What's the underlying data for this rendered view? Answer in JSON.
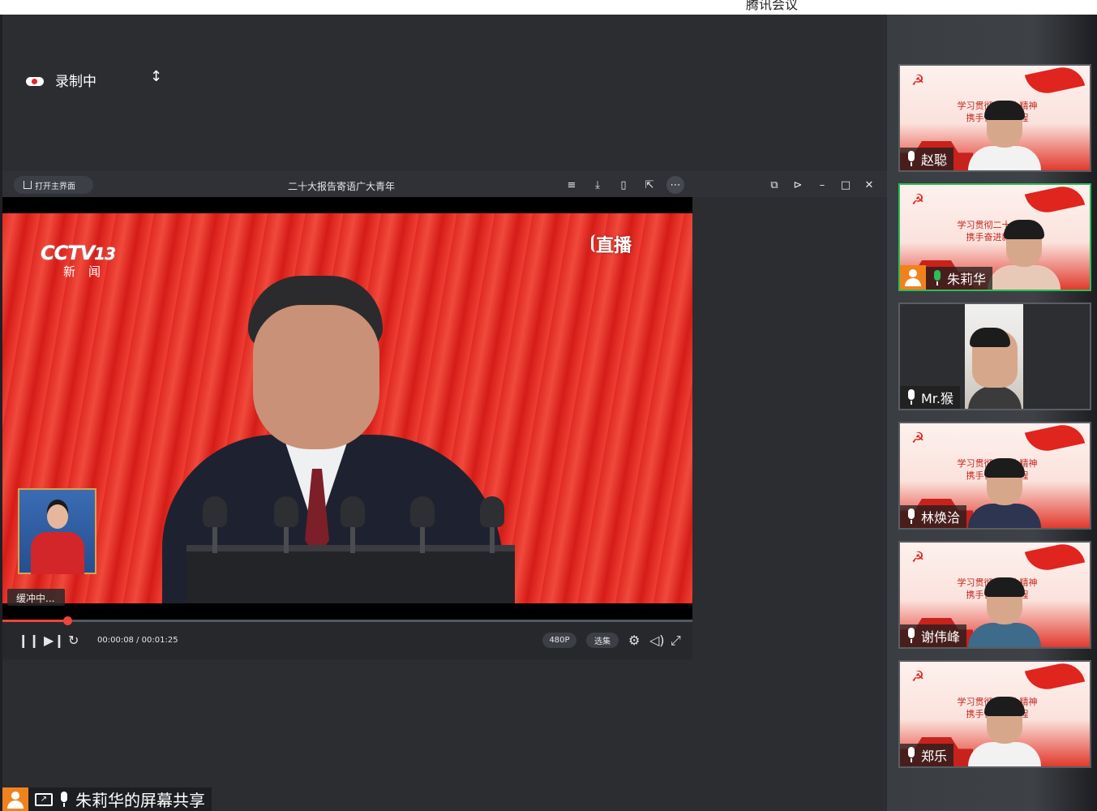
{
  "app": {
    "title": "腾讯会议"
  },
  "recording": {
    "label": "录制中",
    "cursor_icon": "resize-vertical-cursor"
  },
  "player": {
    "home_button": "打开主界面",
    "video_title": "二十大报告寄语广大青年",
    "channel": {
      "logo": "CCTV",
      "number": "13",
      "subtitle": "新闻"
    },
    "live_badge": "直播",
    "buffering": "缓冲中...",
    "time": "00:00:08 / 00:01:25",
    "progress": 0.094,
    "quality": "480P",
    "episodes": "选集",
    "titlebar_icons": [
      "playlist-icon",
      "download-icon",
      "mobile-icon",
      "share-icon",
      "more-icon"
    ],
    "window_icons": [
      "picture-in-picture-icon",
      "pin-icon",
      "minimize-icon",
      "maximize-icon",
      "close-icon"
    ]
  },
  "participants": [
    {
      "name": "赵聪",
      "mic": "white",
      "active": false,
      "host": false,
      "bg": "party"
    },
    {
      "name": "朱莉华",
      "mic": "green",
      "active": true,
      "host": true,
      "bg": "party"
    },
    {
      "name": "Mr.猴",
      "mic": "white",
      "active": false,
      "host": false,
      "bg": "webcam"
    },
    {
      "name": "林焕洽",
      "mic": "white",
      "active": false,
      "host": false,
      "bg": "party"
    },
    {
      "name": "谢伟峰",
      "mic": "white",
      "active": false,
      "host": false,
      "bg": "party"
    },
    {
      "name": "郑乐",
      "mic": "white",
      "active": false,
      "host": false,
      "bg": "party"
    }
  ],
  "tile_slogan": {
    "line1": "学习贯彻二十大精神",
    "line2": "携手奋进新征程"
  },
  "screen_share": {
    "label": "朱莉华的屏幕共享"
  },
  "colors": {
    "accent_red": "#e0241e",
    "active_green": "#2ebd59",
    "host_orange": "#f0821e"
  }
}
